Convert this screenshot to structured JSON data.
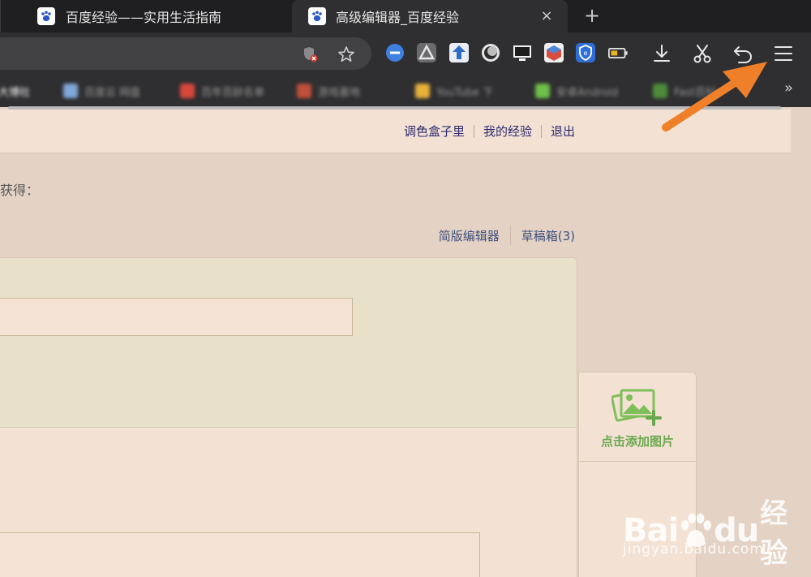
{
  "tabs": [
    {
      "title": "百度经验——实用生活指南",
      "icon": "baidu-paw-icon",
      "active": false
    },
    {
      "title": "高级编辑器_百度经验",
      "icon": "baidu-paw-icon",
      "active": true,
      "close": "×"
    }
  ],
  "new_tab": "+",
  "toolbar": {
    "extensions": [
      "block-icon",
      "triangle-logo-icon",
      "download-box-icon",
      "moon-icon",
      "monitor-icon",
      "cube-icon",
      "shield-icon",
      "battery-icon"
    ],
    "buttons": [
      "download-icon",
      "scissors-icon",
      "undo-icon",
      "menu-icon"
    ]
  },
  "bookmarks": {
    "items": [
      {
        "label": "大博社",
        "color": "#ffffff"
      },
      {
        "label": "百度云 网盘",
        "color": "#7fa7d8"
      },
      {
        "label": "百年百龄名单",
        "color": "#d9473b"
      },
      {
        "label": "游戏基地",
        "color": "#c0503a"
      },
      {
        "label": "YouTube 下",
        "color": "#e8b23a"
      },
      {
        "label": "安卓Android",
        "color": "#6fbf4a"
      },
      {
        "label": "Fast百科",
        "color": "#4e8b3a"
      }
    ],
    "more": "»"
  },
  "page": {
    "user_links": [
      "调色盒子里",
      "我的经验",
      "退出"
    ],
    "gain_text": "获得：",
    "editor_links": {
      "simple": "简版编辑器",
      "drafts": "草稿箱(3)"
    },
    "add_image_label": "点击添加图片",
    "watermark": {
      "brand": "Bai",
      "brand2": "du",
      "brand_cn": "经验",
      "url": "jingyan.baidu.com"
    }
  },
  "colors": {
    "accent_arrow": "#f07f2a",
    "link": "#2d2a6e",
    "green": "#6aa84f"
  }
}
